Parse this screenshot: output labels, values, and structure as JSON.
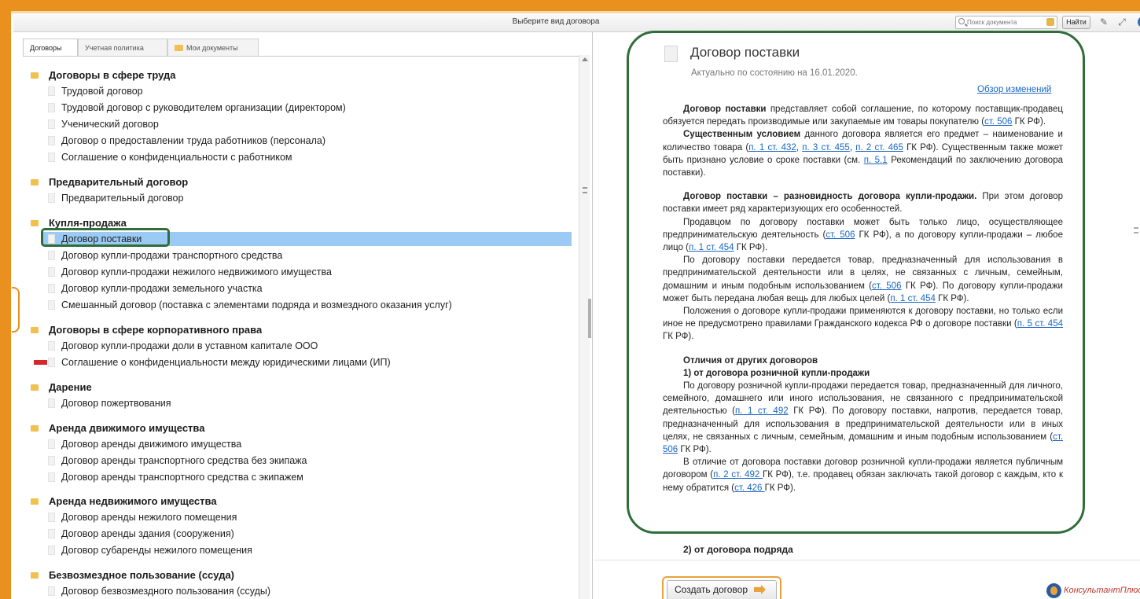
{
  "window": {
    "title": "Выберите вид договора",
    "search_placeholder": "Поиск документа",
    "find_label": "Найти",
    "icons": [
      "eraser-icon",
      "pin-icon",
      "expand-icon",
      "help-icon"
    ]
  },
  "tabs": [
    {
      "label": "Договоры",
      "active": true
    },
    {
      "label": "Учетная политика",
      "active": false
    },
    {
      "label": "Мои документы",
      "active": false,
      "icon": "folder-icon"
    }
  ],
  "tree": [
    {
      "category": "Договоры в сфере труда",
      "items": [
        "Трудовой договор",
        "Трудовой договор с руководителем организации (директором)",
        "Ученический договор",
        "Договор о предоставлении труда работников (персонала)",
        "Соглашение о конфиденциальности с работником"
      ]
    },
    {
      "category": "Предварительный договор",
      "items": [
        "Предварительный договор"
      ]
    },
    {
      "category": "Купля-продажа",
      "items": [
        "Договор поставки",
        "Договор купли-продажи транспортного средства",
        "Договор купли-продажи нежилого недвижимого имущества",
        "Договор купли-продажи земельного участка",
        "Смешанный договор (поставка с элементами подряда и возмездного оказания услуг)"
      ]
    },
    {
      "category": "Договоры в сфере корпоративного права",
      "items": [
        "Договор купли-продажи доли в уставном капитале ООО",
        "Соглашение о конфиденциальности между юридическими лицами (ИП)"
      ]
    },
    {
      "category": "Дарение",
      "items": [
        "Договор пожертвования"
      ]
    },
    {
      "category": "Аренда движимого имущества",
      "items": [
        "Договор аренды движимого имущества",
        "Договор аренды транспортного средства без экипажа",
        "Договор аренды транспортного средства с экипажем"
      ]
    },
    {
      "category": "Аренда недвижимого имущества",
      "items": [
        "Договор аренды нежилого помещения",
        "Договор аренды здания (сооружения)",
        "Договор субаренды нежилого помещения"
      ]
    },
    {
      "category": "Безвозмездное пользование (ссуда)",
      "items": [
        "Договор безвозмездного пользования (ссуды)"
      ]
    }
  ],
  "selected_item": "Договор поставки",
  "new_badge_item": "Соглашение о конфиденциальности между юридическими лицами (ИП)",
  "document": {
    "title": "Договор поставки",
    "date_line": "Актуально по состоянию на 16.01.2020.",
    "review_link": "Обзор изменений",
    "p1_bold": "Договор поставки",
    "p1_text": " представляет собой соглашение, по которому поставщик-продавец обязуется передать производимые или закупаемые им товары покупателю (",
    "p1_link": "ст. 506",
    "p1_tail": " ГК РФ).",
    "p2_bold": "Существенным условием",
    "p2_text": " данного договора является его предмет – наименование и количество товара (",
    "p2_link1": "п. 1 ст. 432",
    "p2_sep1": ", ",
    "p2_link2": "п. 3 ст. 455",
    "p2_sep2": ", ",
    "p2_link3": "п. 2 ст. 465",
    "p2_text2": " ГК РФ). Существенным также может быть признано условие о сроке поставки (см. ",
    "p2_link4": "п. 5.1",
    "p2_tail": " Рекомендаций по заключению договора поставки).",
    "p3_bold": "Договор поставки – разновидность договора купли-продажи.",
    "p3_text": " При этом договор поставки имеет ряд характеризующих его особенностей.",
    "p4_text": "Продавцом по договору поставки может быть только лицо, осуществляющее предпринимательскую деятельность (",
    "p4_link1": "ст. 506",
    "p4_text2": " ГК РФ), а по договору купли-продажи – любое лицо (",
    "p4_link2": "п. 1 ст. 454",
    "p4_tail": " ГК РФ).",
    "p5_text": "По договору поставки передается товар, предназначенный для использования в предпринимательской деятельности или в целях, не связанных с личным, семейным, домашним и иным подобным использованием (",
    "p5_link1": "ст. 506",
    "p5_text2": " ГК РФ). По договору купли-продажи может быть передана любая вещь для любых целей (",
    "p5_link2": "п. 1 ст. 454",
    "p5_tail": " ГК РФ).",
    "p6_text": "Положения о договоре купли-продажи применяются к договору поставки, но только если иное не предусмотрено правилами Гражданского кодекса РФ о договоре поставки (",
    "p6_link": "п. 5 ст. 454",
    "p6_tail": " ГК РФ).",
    "h_differences": "Отличия от других договоров",
    "h_retail": "1) от договора розничной купли-продажи",
    "p7_text": "По договору розничной купли-продажи передается товар, предназначенный для личного, семейного, домашнего или иного использования, не связанного с предпринимательской деятельностью (",
    "p7_link1": "п. 1 ст. 492",
    "p7_text2": " ГК РФ). По договору поставки, напротив, передается товар, предназначенный для использования в предпринимательской деятельности или в иных целях, не связанных с личным, семейным, домашним и иным подобным использованием (",
    "p7_link2": "ст. 506",
    "p7_tail": " ГК РФ).",
    "p8_text": "В отличие от договора поставки договор розничной купли-продажи является публичным договором (",
    "p8_link1": "п. 2 ст. 492 ",
    "p8_text2": "ГК РФ), т.е. продавец обязан заключать такой договор с каждым, кто к нему обратится (",
    "p8_link2": "ст. 426 ",
    "p8_tail": "ГК РФ).",
    "h_contract": "2) от договора подряда"
  },
  "footer": {
    "create_button": "Создать договор",
    "logo": "КонсультантПлюс"
  },
  "colors": {
    "frame": "#e9901f",
    "highlight_outline": "#2f6e3a",
    "selection": "#9bcaf5",
    "link": "#1a66c2"
  }
}
